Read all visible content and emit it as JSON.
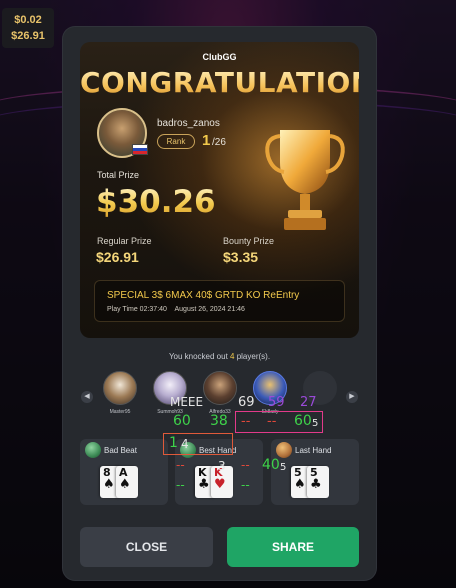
{
  "balance": {
    "line1": "$0.02",
    "line2": "$26.91"
  },
  "card": {
    "logo": "ClubGG",
    "title": "CONGRATULATIONS!",
    "username": "badros_zanos",
    "rank_label": "Rank",
    "rank_value": "1",
    "rank_total": "/26",
    "total_label": "Total Prize",
    "total_value": "$30.26",
    "regular_label": "Regular Prize",
    "regular_value": "$26.91",
    "bounty_label": "Bounty Prize",
    "bounty_value": "$3.35",
    "tournament_name": "SPECIAL 3$ 6MAX 40$ GRTD KO ReEntry",
    "play_time": "Play Time 02:37:40",
    "date": "August 26, 2024 21:46"
  },
  "knockouts": {
    "prefix": "You knocked out ",
    "count": "4",
    "suffix": " player(s).",
    "players": [
      "Master95",
      "Summoh93",
      "Alfredo33",
      "Sk8ady"
    ]
  },
  "hands": [
    {
      "label": "Bad Beat",
      "cards": [
        {
          "rank": "8",
          "suit": "♠",
          "color": "black"
        },
        {
          "rank": "A",
          "suit": "♠",
          "color": "black"
        }
      ]
    },
    {
      "label": "Best Hand",
      "cards": [
        {
          "rank": "K",
          "suit": "♣",
          "color": "black"
        },
        {
          "rank": "K",
          "suit": "♥",
          "color": "red"
        }
      ]
    },
    {
      "label": "Last Hand",
      "cards": [
        {
          "rank": "5",
          "suit": "♠",
          "color": "black"
        },
        {
          "rank": "5",
          "suit": "♣",
          "color": "black"
        }
      ]
    }
  ],
  "buttons": {
    "close": "CLOSE",
    "share": "SHARE"
  },
  "overlay": {
    "meee": "MEEE",
    "n69": "69",
    "n59": "59",
    "n27": "27",
    "n60a": "60",
    "n38": "38",
    "dash1": "--",
    "dash2": "--",
    "n60b": "60",
    "sub5a": "5",
    "n1": "1",
    "n4": "4",
    "dash3": "--",
    "dash4": "--",
    "dash5": "--",
    "dash6": "--",
    "n40": "40",
    "sub5b": "5",
    "n3": "3"
  },
  "colors": {
    "share_green": "#1fa565",
    "gold": "#f2c94c",
    "modal_bg": "#26292e"
  }
}
